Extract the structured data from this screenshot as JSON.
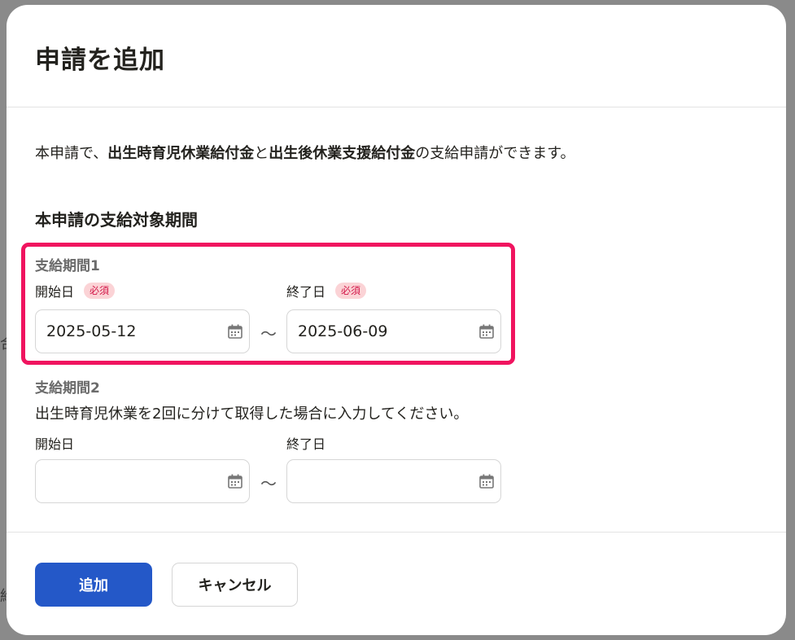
{
  "modal": {
    "title": "申請を追加"
  },
  "intro": {
    "prefix": "本申請で、",
    "bold1": "出生時育児休業給付金",
    "middle": "と",
    "bold2": "出生後休業支援給付金",
    "suffix": "の支給申請ができます。"
  },
  "section_title": "本申請の支給対象期間",
  "period1": {
    "label": "支給期間1",
    "start_label": "開始日",
    "end_label": "終了日",
    "required_badge": "必須",
    "start_value": "2025-05-12",
    "end_value": "2025-06-09",
    "separator": "～"
  },
  "period2": {
    "label": "支給期間2",
    "hint": "出生時育児休業を2回に分けて取得した場合に入力してください。",
    "start_label": "開始日",
    "end_label": "終了日",
    "start_value": "",
    "end_value": "",
    "separator": "～"
  },
  "footer": {
    "add_label": "追加",
    "cancel_label": "キャンセル"
  },
  "icons": {
    "calendar": "calendar-icon"
  },
  "colors": {
    "primary": "#2458c8",
    "highlight": "#f0145f",
    "required_bg": "#fbd3d6",
    "required_text": "#d3194a"
  }
}
